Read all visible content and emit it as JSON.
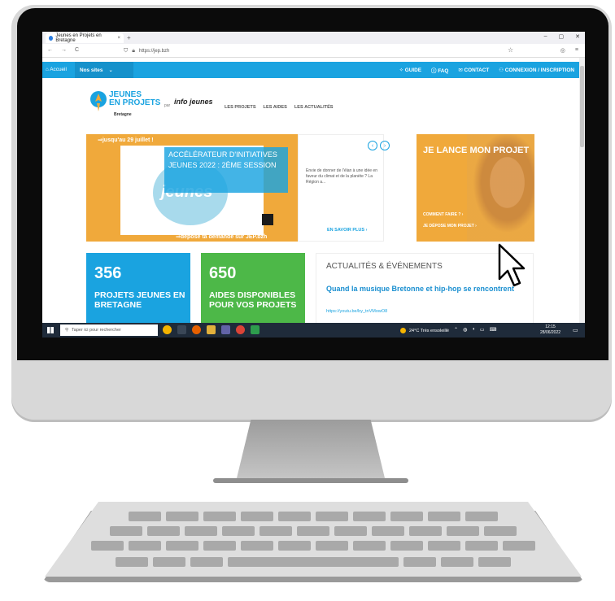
{
  "browser": {
    "tab_title": "Jeunes en Projets en Bretagne",
    "tab_close": "×",
    "new_tab": "+",
    "url": "https://jep.bzh",
    "window_controls": [
      "–",
      "▢",
      "✕"
    ],
    "nav_back": "←",
    "nav_forward": "→",
    "nav_reload": "C"
  },
  "site_nav": {
    "home": "Accueil",
    "sites": "Nos sites",
    "guide": "GUIDE",
    "faq": "FAQ",
    "contact": "CONTACT",
    "login": "CONNEXION / INSCRIPTION"
  },
  "header": {
    "logo_line1": "JEUNES",
    "logo_line2": "EN PROJETS",
    "logo_region": "Bretagne",
    "logo_par": "par",
    "partner": "info jeunes",
    "menu": [
      "LES PROJETS",
      "LES AIDES",
      "LES ACTUALITÉS"
    ]
  },
  "hero": {
    "top": "⇒jusqu'au 29 juillet !",
    "caption": "ACCÉLÉRATEUR D'INITIATIVES JEUNES 2022 : 2ÈME SESSION",
    "circle_text": "jeunes",
    "bottom": "⇒dépose ta demande sur JEP.bzh"
  },
  "description": {
    "text": "Envie de donner de l'élan à une idée en faveur du climat et de la planète ? La Région a...",
    "cta": "EN SAVOIR PLUS  ›",
    "prev": "‹",
    "next": "›"
  },
  "project_card": {
    "title": "JE LANCE MON PROJET",
    "link1": "COMMENT FAIRE ?  ›",
    "link2": "JE DÉPOSE MON PROJET  ›"
  },
  "stats": [
    {
      "number": "356",
      "label": "PROJETS JEUNES EN BRETAGNE"
    },
    {
      "number": "650",
      "label": "AIDES DISPONIBLES POUR VOS PROJETS"
    }
  ],
  "news": {
    "heading": "ACTUALITÉS & ÉVÉNEMENTS",
    "title": "Quand la musique Bretonne et hip-hop se rencontrent",
    "url": "https://youtu.be/by_tnVMowO8"
  },
  "taskbar": {
    "search_placeholder": "Taper ici pour rechercher",
    "weather": "24°C  Très ensoleillé",
    "time": "12:15",
    "date": "28/06/2022"
  },
  "colors": {
    "brand_blue": "#1aa3e0",
    "orange": "#f0a93b",
    "green": "#4db848",
    "taskbar": "#1f2b3a"
  }
}
